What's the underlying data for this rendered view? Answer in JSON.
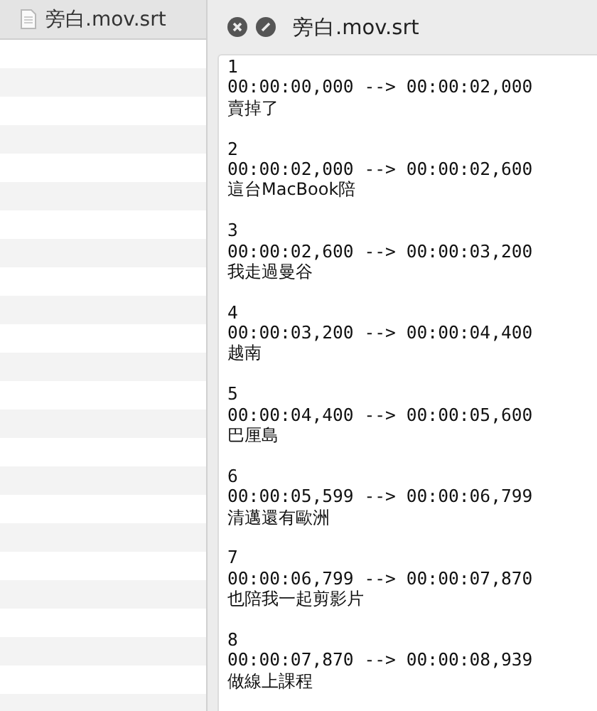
{
  "sidebar": {
    "title": "旁白.mov.srt"
  },
  "window": {
    "title": "旁白.mov.srt"
  },
  "subtitles": [
    {
      "index": "1",
      "time": "00:00:00,000 --> 00:00:02,000",
      "text": "賣掉了"
    },
    {
      "index": "2",
      "time": "00:00:02,000 --> 00:00:02,600",
      "text": "這台MacBook陪"
    },
    {
      "index": "3",
      "time": "00:00:02,600 --> 00:00:03,200",
      "text": "我走過曼谷"
    },
    {
      "index": "4",
      "time": "00:00:03,200 --> 00:00:04,400",
      "text": "越南"
    },
    {
      "index": "5",
      "time": "00:00:04,400 --> 00:00:05,600",
      "text": "巴厘島"
    },
    {
      "index": "6",
      "time": "00:00:05,599 --> 00:00:06,799",
      "text": "清邁還有歐洲"
    },
    {
      "index": "7",
      "time": "00:00:06,799 --> 00:00:07,870",
      "text": "也陪我一起剪影片"
    },
    {
      "index": "8",
      "time": "00:00:07,870 --> 00:00:08,939",
      "text": "做線上課程"
    }
  ]
}
